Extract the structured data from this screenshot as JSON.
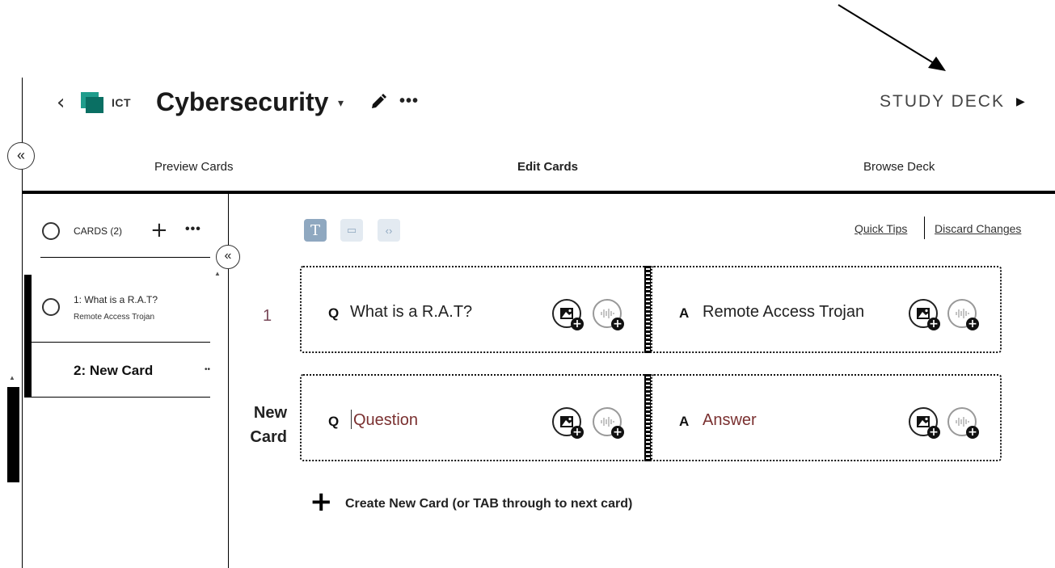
{
  "header": {
    "back_glyph": "‹",
    "deck_code": "ICT",
    "deck_title": "Cybersecurity",
    "title_caret": "▾",
    "more_glyph": "•••",
    "study_label": "STUDY DECK",
    "study_play": "▶"
  },
  "collapse_glyph": "«",
  "tabs": [
    {
      "label": "Preview Cards",
      "active": false
    },
    {
      "label": "Edit Cards",
      "active": true
    },
    {
      "label": "Browse Deck",
      "active": false
    }
  ],
  "sidebar": {
    "cards_label": "CARDS (2)",
    "add_glyph": "+",
    "more_glyph": "•••",
    "items": [
      {
        "title": "1: What is a R.A.T?",
        "subtitle": "Remote Access Trojan"
      },
      {
        "title": "2: New Card",
        "dots": "••"
      }
    ],
    "scroll_up": "▲"
  },
  "toolbar": {
    "text_tool": "T",
    "layout_tool": "▭",
    "code_tool": "‹›",
    "quick_tips": "Quick Tips",
    "discard_changes": "Discard Changes"
  },
  "cards": [
    {
      "row_label": "1",
      "q_letter": "Q",
      "question": "What is a R.A.T?",
      "a_letter": "A",
      "answer": "Remote Access Trojan"
    },
    {
      "row_label_line1": "New",
      "row_label_line2": "Card",
      "q_letter": "Q",
      "question_placeholder": "Question",
      "a_letter": "A",
      "answer_placeholder": "Answer"
    }
  ],
  "media": {
    "image_icon": "image-add-icon",
    "audio_icon": "audio-add-icon",
    "plus_glyph": "+"
  },
  "create": {
    "plus_glyph": "+",
    "label": "Create New Card (or TAB through to next card)"
  },
  "colors": {
    "brand": "#1f9d8c",
    "tool_active": "#8fa8c0",
    "placeholder": "#7a3030"
  }
}
